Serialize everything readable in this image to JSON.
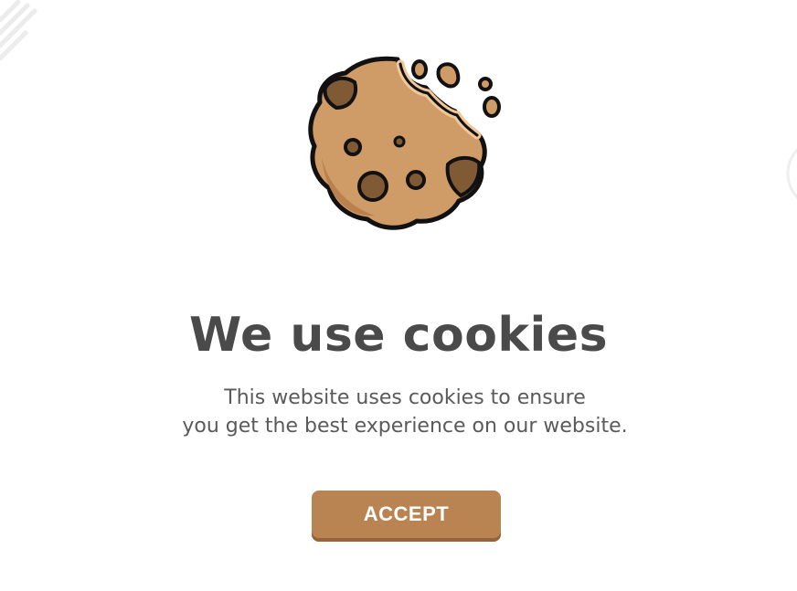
{
  "dialog": {
    "title": "We use cookies",
    "description_line_1": "This website uses cookies to ensure",
    "description_line_2": "you get the best experience on our website.",
    "accept_label": "ACCEPT"
  },
  "icons": {
    "illustration": "bitten-cookie-icon"
  },
  "colors": {
    "title_text": "#4a4a4a",
    "body_text": "#5a5a5a",
    "button_bg": "#b98352",
    "button_shadow": "#96633a",
    "cookie_dough": "#cf9b66",
    "cookie_chip": "#7f5a35"
  }
}
